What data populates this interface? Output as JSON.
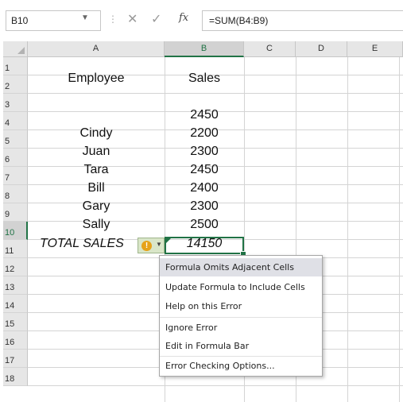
{
  "formula_bar": {
    "name_box": "B10",
    "formula": "=SUM(B4:B9)",
    "fx_label": "fx"
  },
  "columns": [
    "A",
    "B",
    "C",
    "D",
    "E"
  ],
  "rows": [
    "1",
    "2",
    "3",
    "4",
    "5",
    "6",
    "7",
    "8",
    "9",
    "10",
    "11",
    "12",
    "13",
    "14",
    "15",
    "16",
    "17",
    "18"
  ],
  "cells": {
    "A1": "Employee",
    "B1": "Sales",
    "B3": "2450",
    "A4": "Cindy",
    "B4": "2200",
    "A5": "Juan",
    "B5": "2300",
    "A6": "Tara",
    "B6": "2450",
    "A7": "Bill",
    "B7": "2400",
    "A8": "Gary",
    "B8": "2300",
    "A9": "Sally",
    "B9": "2500",
    "A10": "TOTAL SALES",
    "B10": "14150"
  },
  "error_menu": {
    "items": [
      {
        "label": "Formula Omits Adjacent Cells"
      },
      {
        "label": "Update Formula to Include Cells"
      },
      {
        "label": "Help on this Error"
      },
      {
        "label": "Ignore Error"
      },
      {
        "label": "Edit in Formula Bar"
      },
      {
        "label": "Error Checking Options..."
      }
    ]
  },
  "colors": {
    "accent": "#217346",
    "warning": "#e6a31a"
  }
}
